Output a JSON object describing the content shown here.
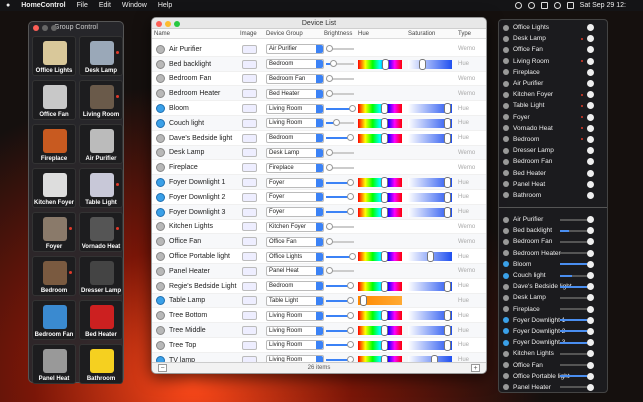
{
  "menubar": {
    "app": "HomeControl",
    "items": [
      "File",
      "Edit",
      "Window",
      "Help"
    ],
    "clock": "Sat Sep 29 12:"
  },
  "group_control": {
    "title": "Group Control",
    "tiles": [
      {
        "label": "Office Lights",
        "color": "#d9c89a",
        "dot": false
      },
      {
        "label": "Desk Lamp",
        "color": "#9aa8b8",
        "dot": true
      },
      {
        "label": "Office Fan",
        "color": "#c8c8c8",
        "dot": false
      },
      {
        "label": "Living Room",
        "color": "#6a5a4a",
        "dot": true
      },
      {
        "label": "Fireplace",
        "color": "#c85a20",
        "dot": false
      },
      {
        "label": "Air Purifier",
        "color": "#bbbbbb",
        "dot": false
      },
      {
        "label": "Kitchen Foyer",
        "color": "#dddddd",
        "dot": false
      },
      {
        "label": "Table Light",
        "color": "#c8c8d8",
        "dot": true
      },
      {
        "label": "Foyer",
        "color": "#8a7a6a",
        "dot": true
      },
      {
        "label": "Vornado Heat",
        "color": "#555555",
        "dot": true
      },
      {
        "label": "Bedroom",
        "color": "#7a5a40",
        "dot": true
      },
      {
        "label": "Dresser Lamp",
        "color": "#444444",
        "dot": false
      },
      {
        "label": "Bedroom Fan",
        "color": "#3a8ad0",
        "dot": false
      },
      {
        "label": "Bed Heater",
        "color": "#cc2020",
        "dot": false
      },
      {
        "label": "Panel Heat",
        "color": "#999999",
        "dot": false
      },
      {
        "label": "Bathroom",
        "color": "#f5d020",
        "dot": false
      }
    ]
  },
  "device_list": {
    "title": "Device List",
    "columns": {
      "name": "Name",
      "image": "Image",
      "group": "Device Group",
      "brightness": "Brightness",
      "hue": "Hue",
      "saturation": "Saturation",
      "type": "Type"
    },
    "rows": [
      {
        "name": "Air Purifier",
        "on": false,
        "group": "Air Purifier",
        "bright": 0,
        "hue": null,
        "sat": null,
        "type": "Wemo"
      },
      {
        "name": "Bed backlight",
        "on": false,
        "group": "Bedroom",
        "bright": 0.3,
        "hue": 0.62,
        "sat": 0.3,
        "type": "Hue"
      },
      {
        "name": "Bedroom Fan",
        "on": false,
        "group": "Bedroom Fan",
        "bright": 0,
        "hue": null,
        "sat": null,
        "type": "Wemo"
      },
      {
        "name": "Bedroom Heater",
        "on": false,
        "group": "Bed Heater",
        "bright": 0,
        "hue": null,
        "sat": null,
        "type": "Wemo"
      },
      {
        "name": "Bloom",
        "on": true,
        "group": "Living Room",
        "bright": 0.95,
        "hue": 0.6,
        "sat": 0.95,
        "type": "Hue"
      },
      {
        "name": "Couch light",
        "on": true,
        "group": "Living Room",
        "bright": 0.4,
        "hue": 0.6,
        "sat": 0.95,
        "type": "Hue"
      },
      {
        "name": "Dave's Bedside light",
        "on": false,
        "group": "Bedroom",
        "bright": 0.9,
        "hue": 0.6,
        "sat": 0.95,
        "type": "Hue"
      },
      {
        "name": "Desk Lamp",
        "on": false,
        "group": "Desk Lamp",
        "bright": 0,
        "hue": null,
        "sat": null,
        "type": "Wemo"
      },
      {
        "name": "Fireplace",
        "on": false,
        "group": "Fireplace",
        "bright": 0,
        "hue": null,
        "sat": null,
        "type": "Wemo"
      },
      {
        "name": "Foyer Downlight 1",
        "on": true,
        "group": "Foyer",
        "bright": 0.9,
        "hue": 0.6,
        "sat": 0.95,
        "type": "Hue"
      },
      {
        "name": "Foyer Downlight 2",
        "on": true,
        "group": "Foyer",
        "bright": 0.9,
        "hue": 0.6,
        "sat": 0.95,
        "type": "Hue"
      },
      {
        "name": "Foyer Downlight 3",
        "on": true,
        "group": "Foyer",
        "bright": 0.9,
        "hue": 0.6,
        "sat": 0.95,
        "type": "Hue"
      },
      {
        "name": "Kitchen Lights",
        "on": false,
        "group": "Kitchen Foyer",
        "bright": 0,
        "hue": null,
        "sat": null,
        "type": "Wemo"
      },
      {
        "name": "Office Fan",
        "on": false,
        "group": "Office Fan",
        "bright": 0,
        "hue": null,
        "sat": null,
        "type": "Wemo"
      },
      {
        "name": "Office Portable light",
        "on": false,
        "group": "Office Lights",
        "bright": 0.95,
        "hue": 0.6,
        "sat": 0.5,
        "type": "Hue"
      },
      {
        "name": "Panel Heater",
        "on": false,
        "group": "Panel Heat",
        "bright": 0,
        "hue": null,
        "sat": null,
        "type": "Wemo"
      },
      {
        "name": "Regie's Bedside Light",
        "on": false,
        "group": "Bedroom",
        "bright": 0.9,
        "hue": 0.6,
        "sat": 0.95,
        "type": "Hue"
      },
      {
        "name": "Table Lamp",
        "on": true,
        "group": "Table Light",
        "bright": 0.9,
        "hue": 0.05,
        "hueOrange": true,
        "sat": null,
        "type": "Hue"
      },
      {
        "name": "Tree Bottom",
        "on": false,
        "group": "Living Room",
        "bright": 0.9,
        "hue": 0.6,
        "sat": 0.95,
        "type": "Hue"
      },
      {
        "name": "Tree Middle",
        "on": false,
        "group": "Living Room",
        "bright": 0.9,
        "hue": 0.6,
        "sat": 0.95,
        "type": "Hue"
      },
      {
        "name": "Tree Top",
        "on": false,
        "group": "Living Room",
        "bright": 0.9,
        "hue": 0.6,
        "sat": 0.95,
        "type": "Hue"
      },
      {
        "name": "TV lamp",
        "on": true,
        "group": "Living Room",
        "bright": 0.9,
        "hue": 0.6,
        "sat": 0.6,
        "type": "Hue"
      }
    ],
    "footer": "26 items"
  },
  "right_panel": {
    "groups": [
      {
        "label": "Office Lights",
        "dot": false
      },
      {
        "label": "Desk Lamp",
        "dot": true
      },
      {
        "label": "Office Fan",
        "dot": false
      },
      {
        "label": "Living Room",
        "dot": true
      },
      {
        "label": "Fireplace",
        "dot": false
      },
      {
        "label": "Air Purifier",
        "dot": false
      },
      {
        "label": "Kitchen Foyer",
        "dot": true
      },
      {
        "label": "Table Light",
        "dot": true
      },
      {
        "label": "Foyer",
        "dot": true
      },
      {
        "label": "Vornado Heat",
        "dot": true
      },
      {
        "label": "Bedroom",
        "dot": true
      },
      {
        "label": "Dresser Lamp",
        "dot": false
      },
      {
        "label": "Bedroom Fan",
        "dot": false
      },
      {
        "label": "Bed Heater",
        "dot": false
      },
      {
        "label": "Panel Heat",
        "dot": false
      },
      {
        "label": "Bathroom",
        "dot": false
      }
    ],
    "devices": [
      {
        "label": "Air Purifier",
        "on": false,
        "level": 0
      },
      {
        "label": "Bed backlight",
        "on": false,
        "level": 0.3
      },
      {
        "label": "Bedroom Fan",
        "on": false,
        "level": 0
      },
      {
        "label": "Bedroom Heater",
        "on": false,
        "level": 0
      },
      {
        "label": "Bloom",
        "on": true,
        "level": 0.9
      },
      {
        "label": "Couch light",
        "on": true,
        "level": 0.4
      },
      {
        "label": "Dave's Bedside light",
        "on": false,
        "level": 0.9
      },
      {
        "label": "Desk Lamp",
        "on": false,
        "level": 0
      },
      {
        "label": "Fireplace",
        "on": false,
        "level": 0
      },
      {
        "label": "Foyer Downlight 1",
        "on": true,
        "level": 0.9
      },
      {
        "label": "Foyer Downlight 2",
        "on": true,
        "level": 0.9
      },
      {
        "label": "Foyer Downlight 3",
        "on": true,
        "level": 0.9
      },
      {
        "label": "Kitchen Lights",
        "on": false,
        "level": 0
      },
      {
        "label": "Office Fan",
        "on": false,
        "level": 0
      },
      {
        "label": "Office Portable light",
        "on": false,
        "level": 0.9
      },
      {
        "label": "Panel Heater",
        "on": false,
        "level": 0
      }
    ]
  }
}
